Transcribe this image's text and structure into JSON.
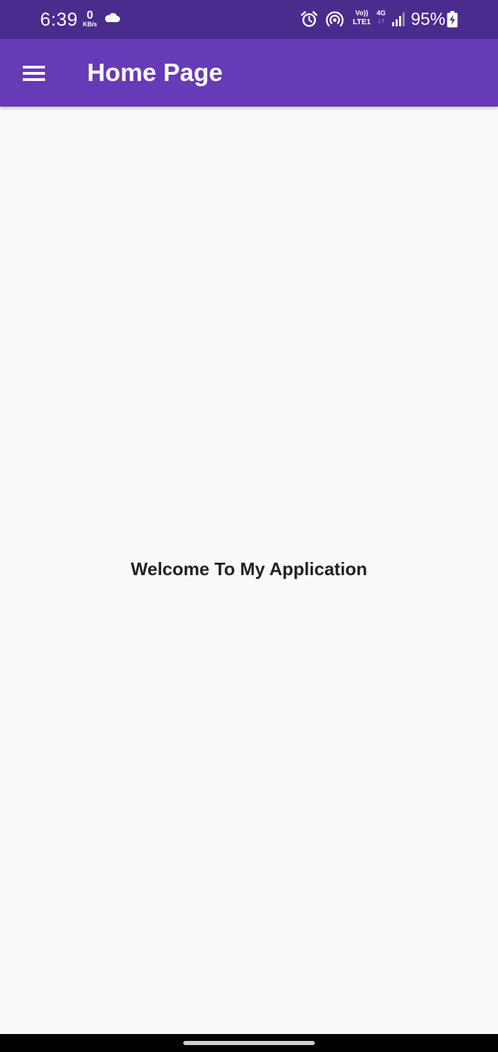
{
  "status_bar": {
    "time": "6:39",
    "net_speed_value": "0",
    "net_speed_unit": "KB/s",
    "volte_top": "Vo))",
    "volte_bottom": "LTE1",
    "network_type": "4G",
    "network_arrows": "↓↑",
    "battery_percent": "95%",
    "icons": [
      "cloud-icon",
      "alarm-icon",
      "hotspot-icon",
      "signal-icon",
      "battery-charging-icon"
    ],
    "background_color": "#4a2c8f"
  },
  "app_bar": {
    "title": "Home Page",
    "menu_icon": "hamburger-menu-icon",
    "background_color": "#673ab7"
  },
  "main": {
    "welcome_text": "Welcome To My Application"
  }
}
